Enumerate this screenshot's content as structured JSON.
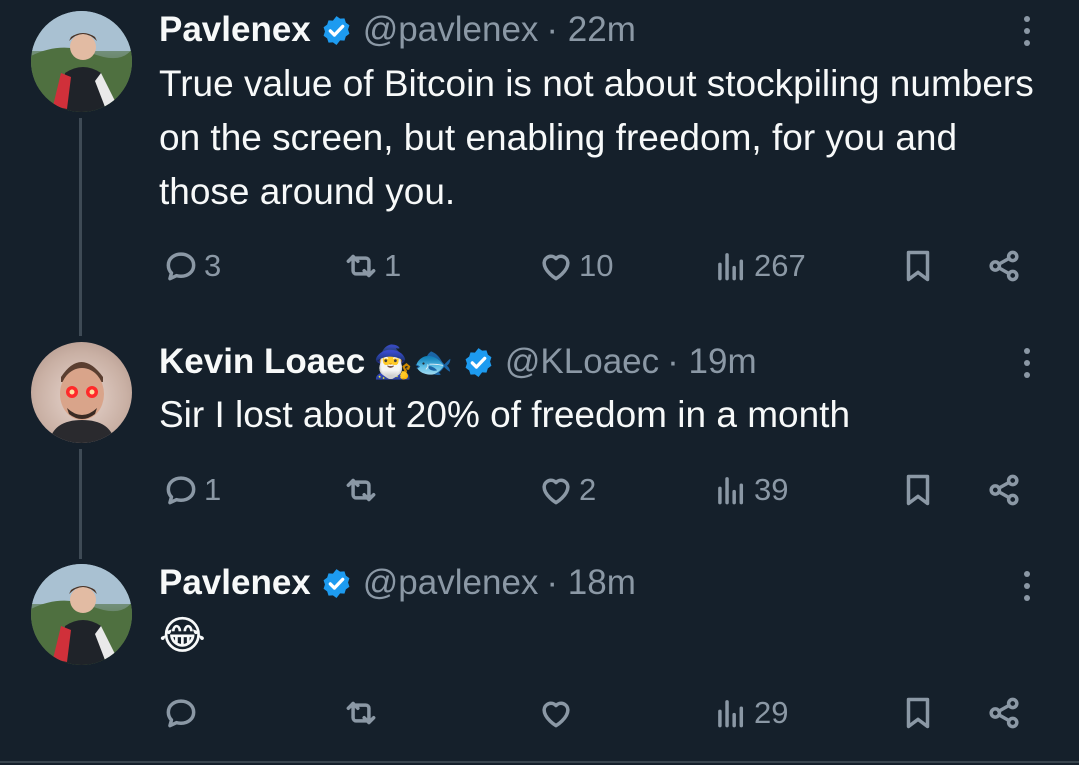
{
  "tweets": [
    {
      "name": "Pavlenex",
      "handle": "@pavlenex",
      "time": "· 22m",
      "text": "True value of Bitcoin is not about stockpiling numbers on the screen, but enabling freedom, for you and those around you.",
      "replies": "3",
      "retweets": "1",
      "likes": "10",
      "views": "267"
    },
    {
      "name": "Kevin Loaec",
      "badges": "🧙‍♂️🐟",
      "handle": "@KLoaec",
      "time": "· 19m",
      "text": "Sir I lost about 20% of freedom in a month",
      "replies": "1",
      "retweets": "",
      "likes": "2",
      "views": "39"
    },
    {
      "name": "Pavlenex",
      "handle": "@pavlenex",
      "time": "· 18m",
      "text": "😂",
      "replies": "",
      "retweets": "",
      "likes": "",
      "views": "29"
    }
  ],
  "colors": {
    "background": "#15202b",
    "muted": "#8b98a5",
    "verified": "#1d9bf0"
  }
}
